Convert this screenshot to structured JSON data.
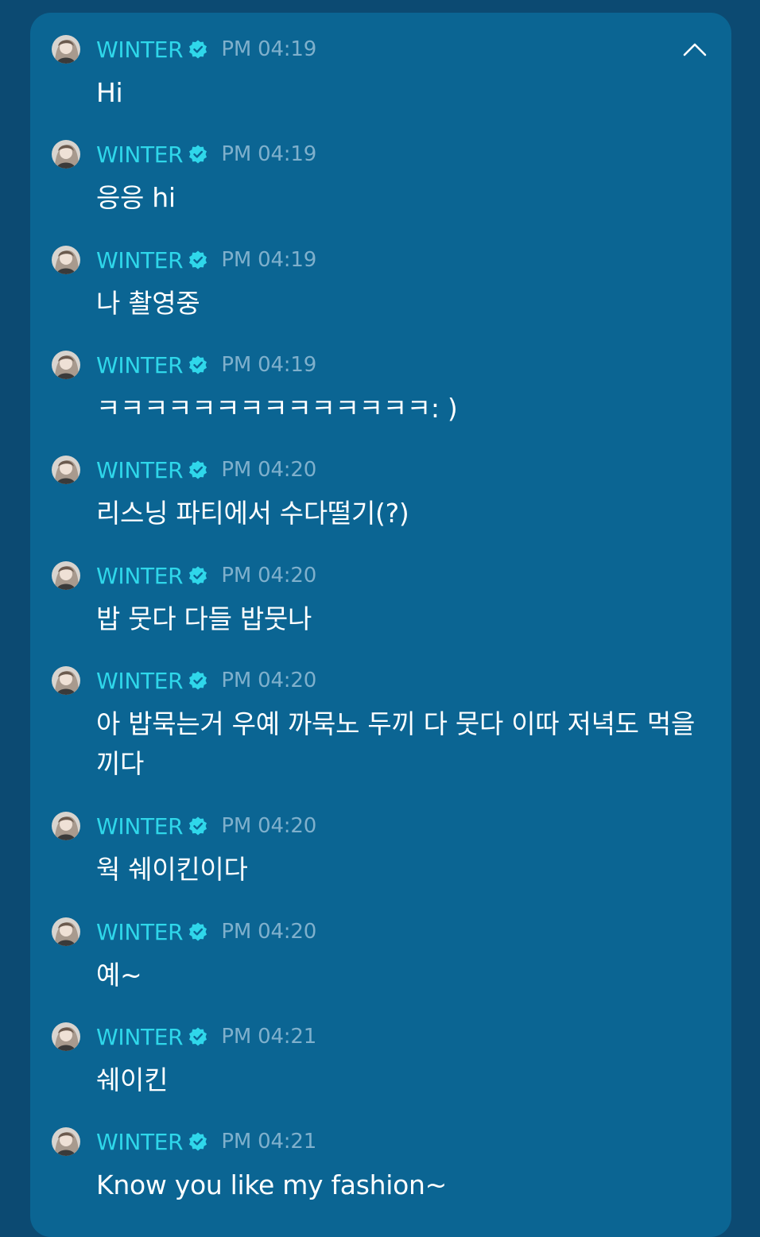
{
  "colors": {
    "background": "#0c4a72",
    "panel": "#0b6593",
    "name": "#2fd7ea",
    "time": "#7fb0cc",
    "message": "#ffffff"
  },
  "collapse_icon": "chevron-up-icon",
  "verified_icon": "verified-badge-icon",
  "messages": [
    {
      "name": "WINTER",
      "time": "PM 04:19",
      "text": "Hi"
    },
    {
      "name": "WINTER",
      "time": "PM 04:19",
      "text": "응응 hi"
    },
    {
      "name": "WINTER",
      "time": "PM 04:19",
      "text": "나 촬영중"
    },
    {
      "name": "WINTER",
      "time": "PM 04:19",
      "text": "ㅋㅋㅋㅋㅋㅋㅋㅋㅋㅋㅋㅋㅋㅋ: )"
    },
    {
      "name": "WINTER",
      "time": "PM 04:20",
      "text": "리스닝 파티에서 수다떨기(?)"
    },
    {
      "name": "WINTER",
      "time": "PM 04:20",
      "text": "밥 뭇다 다들 밥뭇나"
    },
    {
      "name": "WINTER",
      "time": "PM 04:20",
      "text": "아 밥묵는거 우예 까묵노 두끼 다 뭇다 이따 저녁도 먹을끼다"
    },
    {
      "name": "WINTER",
      "time": "PM 04:20",
      "text": "웍 쉐이킨이다"
    },
    {
      "name": "WINTER",
      "time": "PM 04:20",
      "text": "예~"
    },
    {
      "name": "WINTER",
      "time": "PM 04:21",
      "text": "쉐이킨"
    },
    {
      "name": "WINTER",
      "time": "PM 04:21",
      "text": "Know you like my fashion~"
    }
  ]
}
